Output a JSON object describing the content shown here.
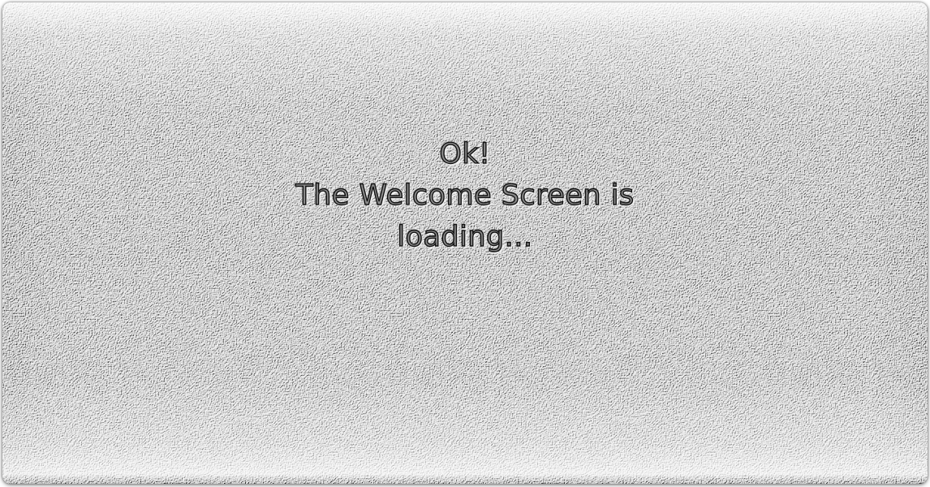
{
  "loading_message": {
    "line1": "Ok!",
    "line2": "The Welcome Screen is",
    "line3": "loading..."
  },
  "colors": {
    "panel": "#9c9c9c",
    "text_outline": "#111111"
  }
}
